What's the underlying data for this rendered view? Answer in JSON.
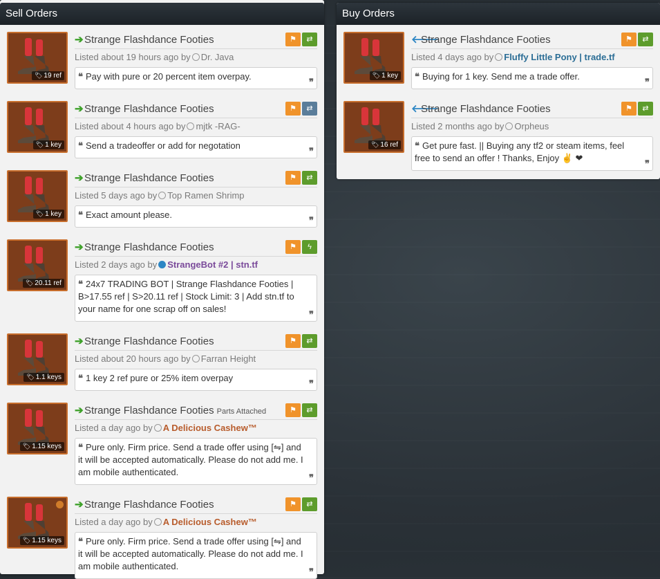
{
  "sell": {
    "header": "Sell Orders",
    "listings": [
      {
        "title": "Strange Flashdance Footies",
        "parts": "",
        "time": "Listed about 19 hours ago by",
        "user": "Dr. Java",
        "user_style": "plain",
        "status": "offline",
        "price": "19 ref",
        "comment": "Pay with pure or 20 percent item overpay.",
        "btn2": "trade",
        "unusual": false
      },
      {
        "title": "Strange Flashdance Footies",
        "parts": "",
        "time": "Listed about 4 hours ago by",
        "user": "mjtk -RAG-",
        "user_style": "plain",
        "status": "offline",
        "price": "1 key",
        "comment": "Send a tradeoffer or add for negotation",
        "btn2": "trade-blue",
        "unusual": false
      },
      {
        "title": "Strange Flashdance Footies",
        "parts": "",
        "time": "Listed 5 days ago by",
        "user": "Top Ramen Shrimp",
        "user_style": "plain",
        "status": "offline",
        "price": "1 key",
        "comment": "Exact amount please.",
        "btn2": "trade",
        "unusual": false
      },
      {
        "title": "Strange Flashdance Footies",
        "parts": "",
        "time": "Listed 2 days ago by",
        "user": "StrangeBot #2 | stn.tf",
        "user_style": "bot",
        "status": "online",
        "price": "20.11 ref",
        "comment": "24x7 TRADING BOT | Strange Flashdance Footies | B>17.55 ref | S>20.11 ref | Stock Limit: 3 | Add stn.tf to your name for one scrap off on sales!",
        "btn2": "bolt",
        "unusual": false
      },
      {
        "title": "Strange Flashdance Footies",
        "parts": "",
        "time": "Listed about 20 hours ago by",
        "user": "Farran Height",
        "user_style": "plain",
        "status": "offline",
        "price": "1.1 keys",
        "comment": "1 key 2 ref pure or 25% item overpay",
        "btn2": "trade",
        "unusual": false
      },
      {
        "title": "Strange Flashdance Footies",
        "parts": "Parts Attached",
        "time": "Listed a day ago by",
        "user": "A Delicious Cashew™",
        "user_style": "orange",
        "status": "offline",
        "price": "1.15 keys",
        "comment": "Pure only. Firm price. Send a trade offer using [⇋] and it will be accepted automatically. Please do not add me. I am mobile authenticated.",
        "btn2": "trade",
        "unusual": false
      },
      {
        "title": "Strange Flashdance Footies",
        "parts": "",
        "time": "Listed a day ago by",
        "user": "A Delicious Cashew™",
        "user_style": "orange",
        "status": "offline",
        "price": "1.15 keys",
        "comment": "Pure only. Firm price. Send a trade offer using [⇋] and it will be accepted automatically. Please do not add me. I am mobile authenticated.",
        "btn2": "trade",
        "unusual": true
      }
    ]
  },
  "buy": {
    "header": "Buy Orders",
    "listings": [
      {
        "title": "Strange Flashdance Footies",
        "parts": "",
        "time": "Listed 4 days ago by",
        "user": "Fluffy Little Pony | trade.tf",
        "user_style": "premium",
        "status": "offline",
        "price": "1 key",
        "comment": "Buying for 1 key. Send me a trade offer.",
        "btn2": "trade",
        "unusual": false
      },
      {
        "title": "Strange Flashdance Footies",
        "parts": "",
        "time": "Listed 2 months ago by",
        "user": "Orpheus",
        "user_style": "plain",
        "status": "offline",
        "price": "16 ref",
        "comment": "Get pure fast. || Buying any tf2 or steam items, feel free to send an offer ! Thanks, Enjoy ✌ ❤",
        "btn2": "trade",
        "unusual": false
      }
    ]
  },
  "icons": {
    "sell_arrow": "➔",
    "buy_arrow": "🡐",
    "flag": "⚑",
    "trade": "⇄",
    "bolt": "ϟ",
    "tag": "🏷",
    "quote_open": "❝",
    "quote_close": "❞"
  },
  "colors": {
    "item_bg": "#7d3d1b",
    "item_border": "#c86e2c",
    "flag_btn": "#f0932b",
    "trade_btn": "#5d9c2c"
  }
}
